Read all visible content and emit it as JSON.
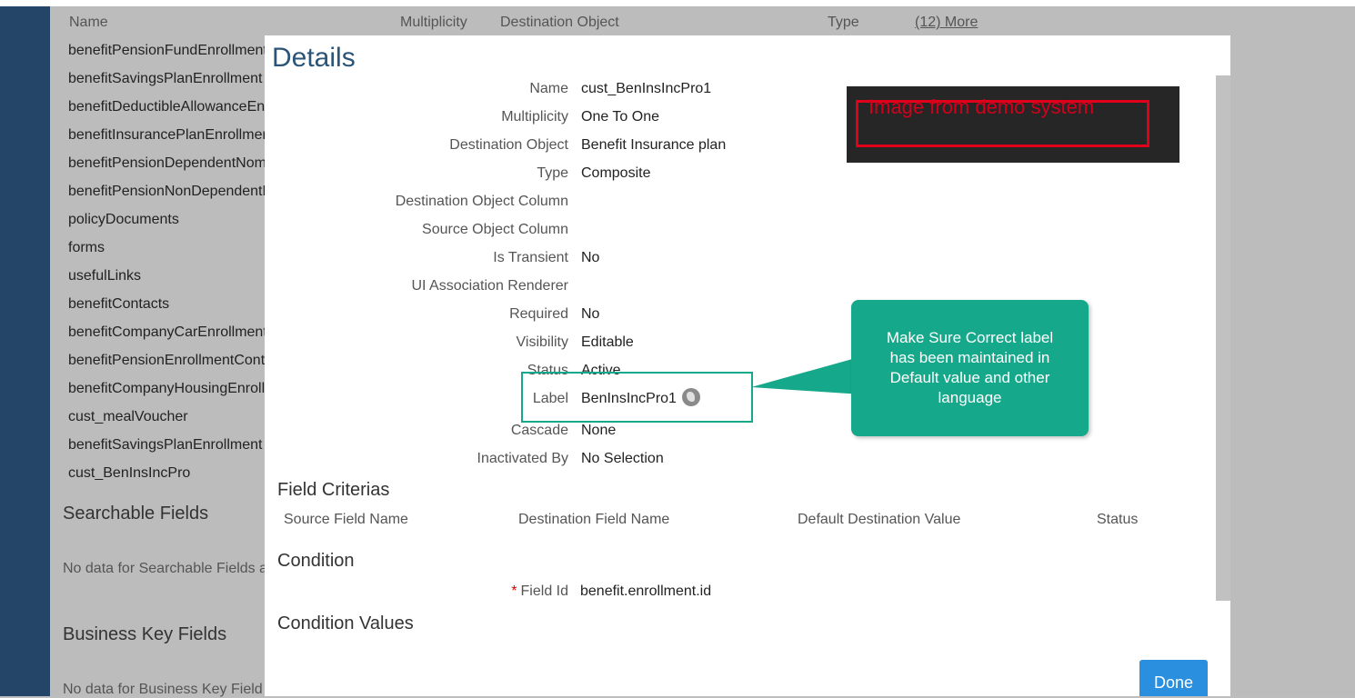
{
  "background": {
    "headers": {
      "name": "Name",
      "multiplicity": "Multiplicity",
      "destination_object": "Destination Object",
      "type": "Type",
      "more": "(12) More"
    },
    "list": [
      "benefitPensionFundEnrollment",
      "benefitSavingsPlanEnrollment",
      "benefitDeductibleAllowanceEnrollment",
      "benefitInsurancePlanEnrollment",
      "benefitPensionDependentNomination",
      "benefitPensionNonDependentNomination",
      "policyDocuments",
      "forms",
      "usefulLinks",
      "benefitContacts",
      "benefitCompanyCarEnrollment",
      "benefitPensionEnrollmentContribution",
      "benefitCompanyHousingEnrollment",
      "cust_mealVoucher",
      "benefitSavingsPlanEnrollment",
      "cust_BenInsIncPro"
    ],
    "searchable_fields_title": "Searchable Fields",
    "searchable_fields_nodata": "No data for Searchable Fields a",
    "business_key_title": "Business Key Fields",
    "business_key_nodata": "No data for Business Key Field"
  },
  "modal": {
    "title": "Details",
    "fields": [
      {
        "label": "Name",
        "value": "cust_BenInsIncPro1"
      },
      {
        "label": "Multiplicity",
        "value": "One To One"
      },
      {
        "label": "Destination Object",
        "value": "Benefit Insurance plan"
      },
      {
        "label": "Type",
        "value": "Composite"
      },
      {
        "label": "Destination Object Column",
        "value": ""
      },
      {
        "label": "Source Object Column",
        "value": ""
      },
      {
        "label": "Is Transient",
        "value": "No"
      },
      {
        "label": "UI Association Renderer",
        "value": ""
      },
      {
        "label": "Required",
        "value": "No"
      },
      {
        "label": "Visibility",
        "value": "Editable"
      },
      {
        "label": "Status",
        "value": "Active"
      },
      {
        "label": "Label",
        "value": "BenInsIncPro1"
      },
      {
        "label": "Cascade",
        "value": "None"
      },
      {
        "label": "Inactivated By",
        "value": "No Selection"
      }
    ],
    "field_criterias_title": "Field Criterias",
    "criteria_headers": [
      "Source Field Name",
      "Destination Field Name",
      "Default Destination Value",
      "Status"
    ],
    "condition_title": "Condition",
    "condition_field_label": "Field Id",
    "condition_field_required_mark": "*",
    "condition_field_value": "benefit.enrollment.id",
    "condition_values_title": "Condition Values",
    "done_label": "Done"
  },
  "annotations": {
    "demo_banner": "Image from demo system",
    "callout": "Make Sure Correct label has been maintained in Default value and other language"
  },
  "colors": {
    "modal_title": "#2a5478",
    "done_button": "#2b8fe0",
    "callout": "#16a88a",
    "demo_text": "#d3001b",
    "sidebar": "#244567"
  },
  "icons": {
    "label_translation": "globe-icon"
  }
}
